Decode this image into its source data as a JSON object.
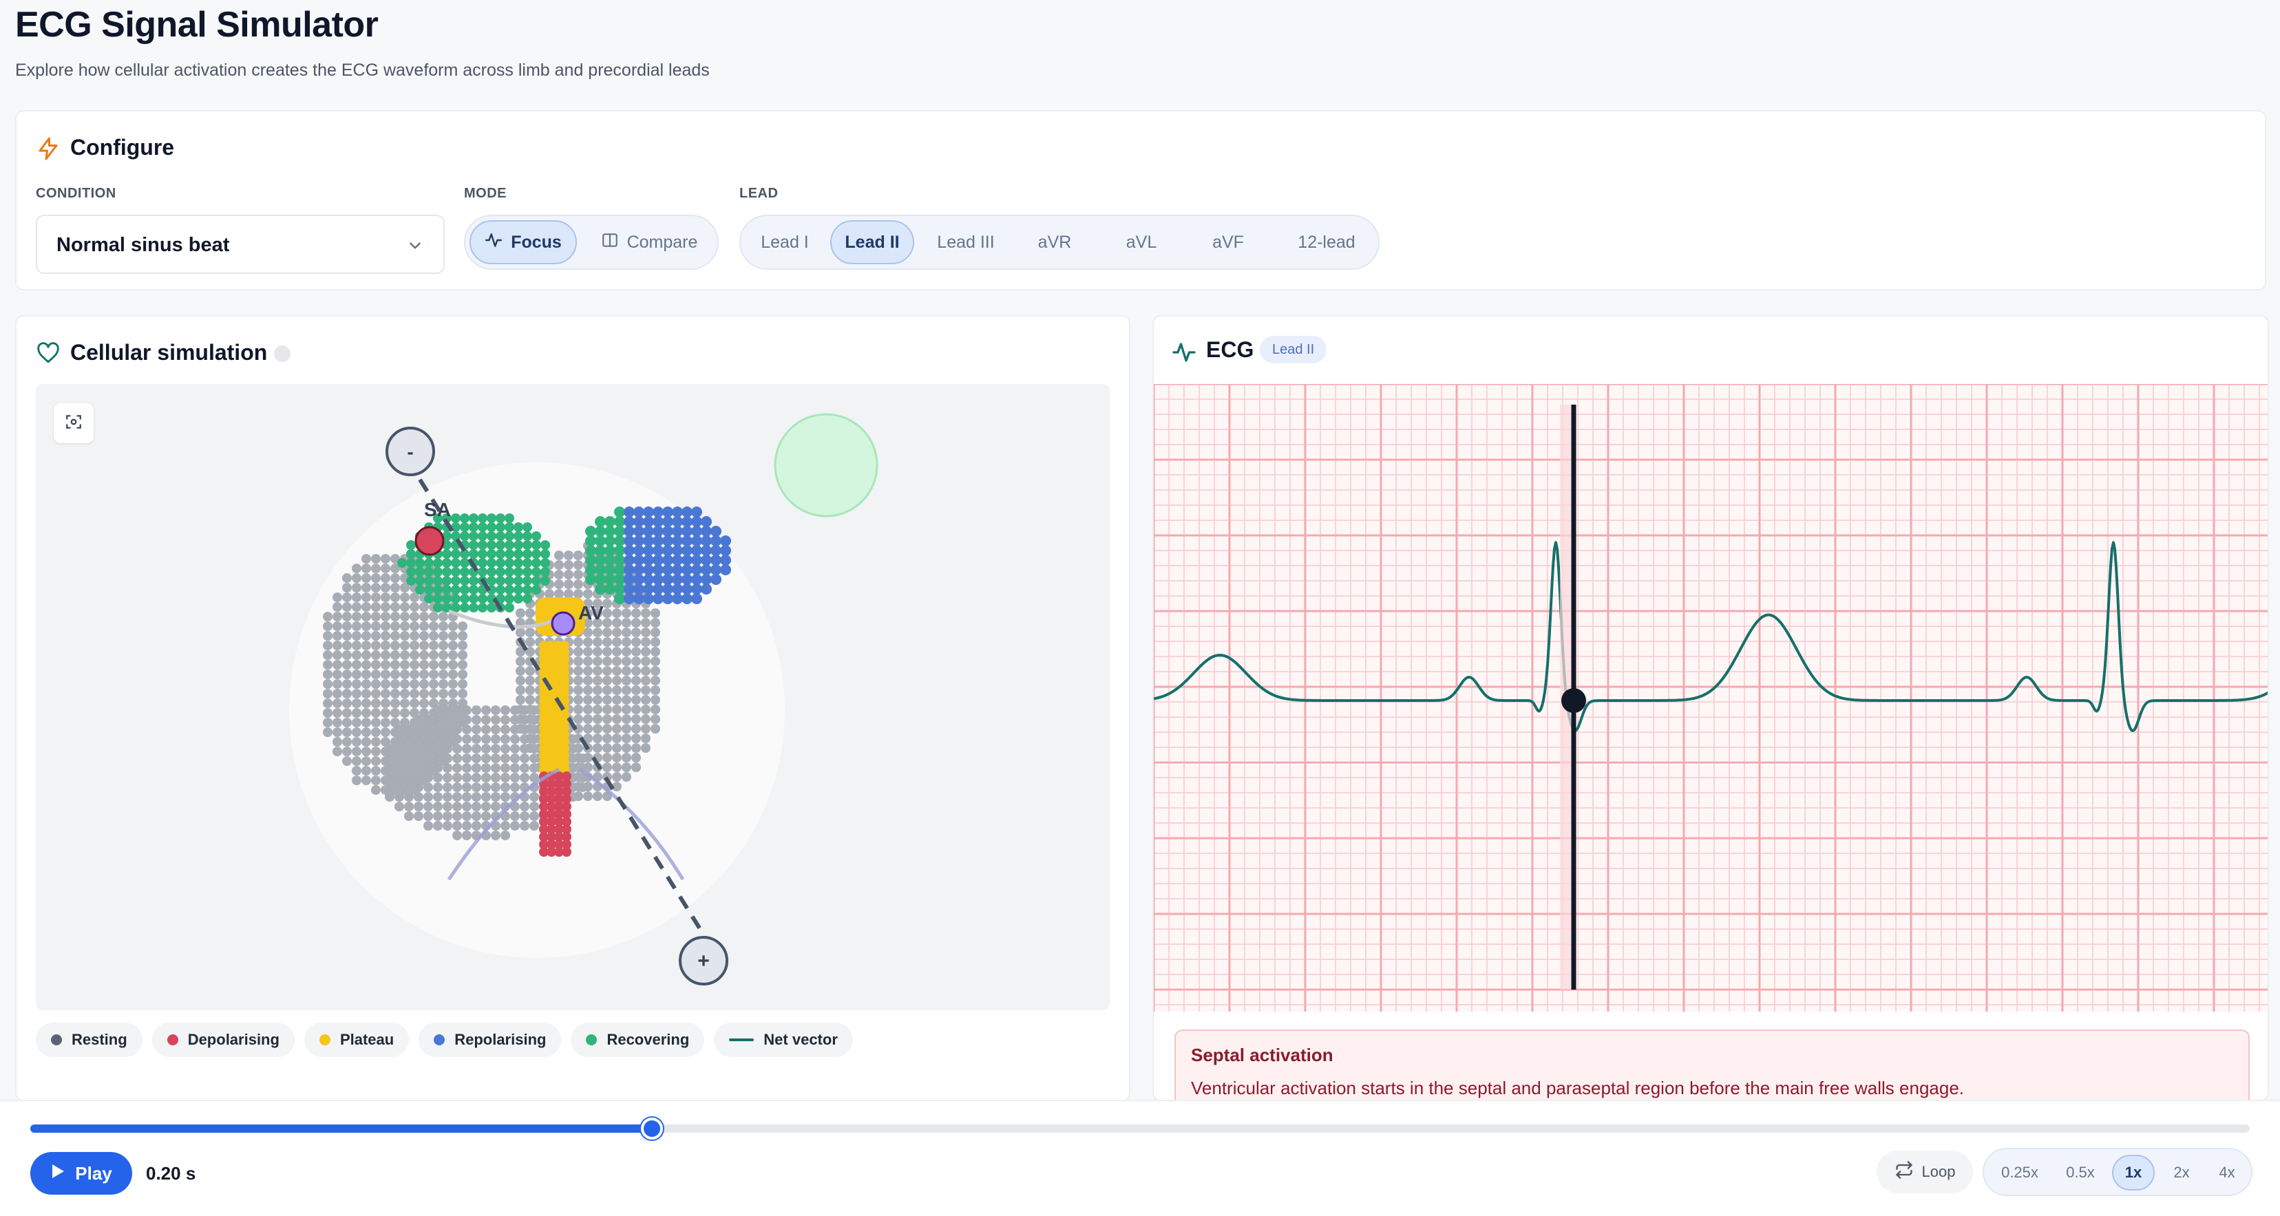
{
  "header": {
    "title": "ECG Signal Simulator",
    "subtitle": "Explore how cellular activation creates the ECG waveform across limb and precordial leads"
  },
  "configure": {
    "title": "Configure",
    "condition_label": "CONDITION",
    "condition_value": "Normal sinus beat",
    "mode_label": "MODE",
    "modes": [
      {
        "label": "Focus",
        "active": true
      },
      {
        "label": "Compare",
        "active": false
      }
    ],
    "lead_label": "LEAD",
    "leads": [
      {
        "label": "Lead I",
        "active": false
      },
      {
        "label": "Lead II",
        "active": true
      },
      {
        "label": "Lead III",
        "active": false
      },
      {
        "label": "aVR",
        "active": false
      },
      {
        "label": "aVL",
        "active": false
      },
      {
        "label": "aVF",
        "active": false
      },
      {
        "label": "12-lead",
        "active": false
      }
    ]
  },
  "simulation": {
    "title": "Cellular simulation",
    "electrode_negative": "-",
    "electrode_positive": "+",
    "sa_label": "SA",
    "av_label": "AV",
    "legend": [
      {
        "label": "Resting",
        "color": "#5b6477",
        "kind": "dot"
      },
      {
        "label": "Depolarising",
        "color": "#d6455b",
        "kind": "dot"
      },
      {
        "label": "Plateau",
        "color": "#f5c518",
        "kind": "dot"
      },
      {
        "label": "Repolarising",
        "color": "#4a77d4",
        "kind": "dot"
      },
      {
        "label": "Recovering",
        "color": "#2fb47c",
        "kind": "dot"
      },
      {
        "label": "Net vector",
        "color": "#14706a",
        "kind": "line"
      }
    ]
  },
  "ecg": {
    "title": "ECG",
    "lead_badge": "Lead II",
    "trace_color": "#14706a",
    "grid_color": "#f4a9b0",
    "info_title": "Septal activation",
    "info_text": "Ventricular activation starts in the septal and paraseptal region before the main free walls engage."
  },
  "playback": {
    "play_label": "Play",
    "time": "0.20 s",
    "progress": 0.28,
    "loop_label": "Loop",
    "speeds": [
      {
        "label": "0.25x",
        "active": false
      },
      {
        "label": "0.5x",
        "active": false
      },
      {
        "label": "1x",
        "active": true
      },
      {
        "label": "2x",
        "active": false
      },
      {
        "label": "4x",
        "active": false
      }
    ]
  }
}
